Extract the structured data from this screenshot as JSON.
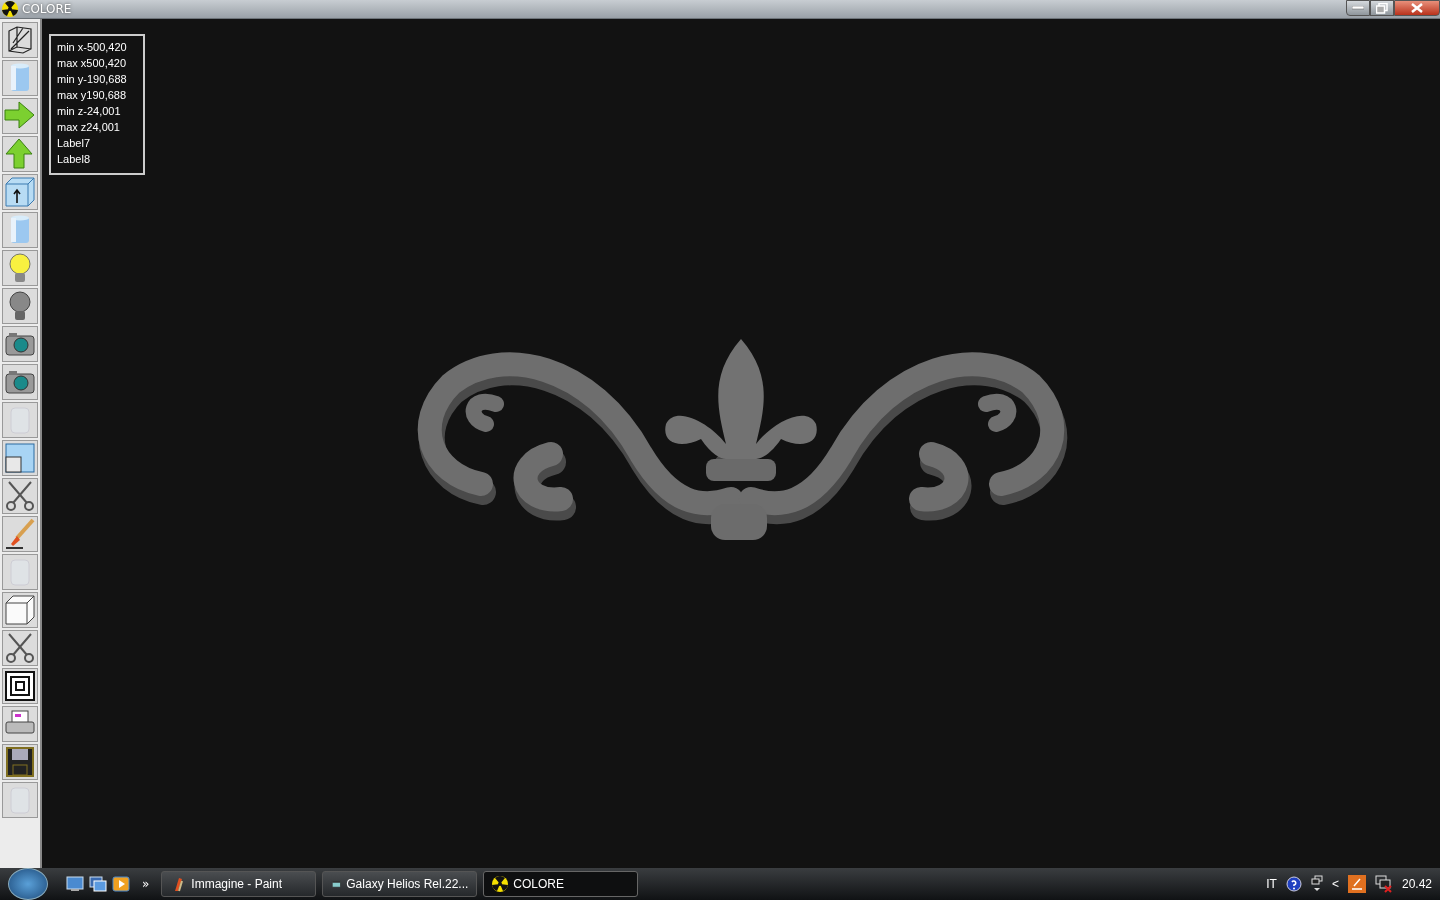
{
  "window": {
    "title": "COLORE"
  },
  "toolbar": [
    {
      "kind": "wireframe",
      "disabled": false
    },
    {
      "kind": "cylinder",
      "disabled": false
    },
    {
      "kind": "arrow-right",
      "disabled": false
    },
    {
      "kind": "arrow-up",
      "disabled": false
    },
    {
      "kind": "cube-arrow",
      "disabled": false
    },
    {
      "kind": "cylinder",
      "disabled": false
    },
    {
      "kind": "bulb-on",
      "disabled": false
    },
    {
      "kind": "bulb-off",
      "disabled": false
    },
    {
      "kind": "camera",
      "disabled": false
    },
    {
      "kind": "camera",
      "disabled": false
    },
    {
      "kind": "jar",
      "disabled": true
    },
    {
      "kind": "split",
      "disabled": false
    },
    {
      "kind": "scissors",
      "disabled": false
    },
    {
      "kind": "brush",
      "disabled": false
    },
    {
      "kind": "jar",
      "disabled": true
    },
    {
      "kind": "cube",
      "disabled": false
    },
    {
      "kind": "scissors",
      "disabled": false
    },
    {
      "kind": "target",
      "disabled": false
    },
    {
      "kind": "printer",
      "disabled": false
    },
    {
      "kind": "floppy",
      "disabled": false
    },
    {
      "kind": "jar",
      "disabled": true
    }
  ],
  "info_box": [
    "min x-500,420",
    "max x500,420",
    "min y-190,688",
    "max y190,688",
    "min z-24,001",
    "max z24,001",
    "Label7",
    "Label8"
  ],
  "taskbar": {
    "overflow": "»",
    "tasks": [
      {
        "title": "Immagine - Paint",
        "kind": "paint",
        "selected": false
      },
      {
        "title": "Galaxy Helios  Rel.22...",
        "kind": "app",
        "selected": false
      },
      {
        "title": "COLORE",
        "kind": "radiation",
        "selected": true
      }
    ],
    "tray": {
      "language": "IT",
      "chevron": "<",
      "clock": "20.42"
    }
  }
}
